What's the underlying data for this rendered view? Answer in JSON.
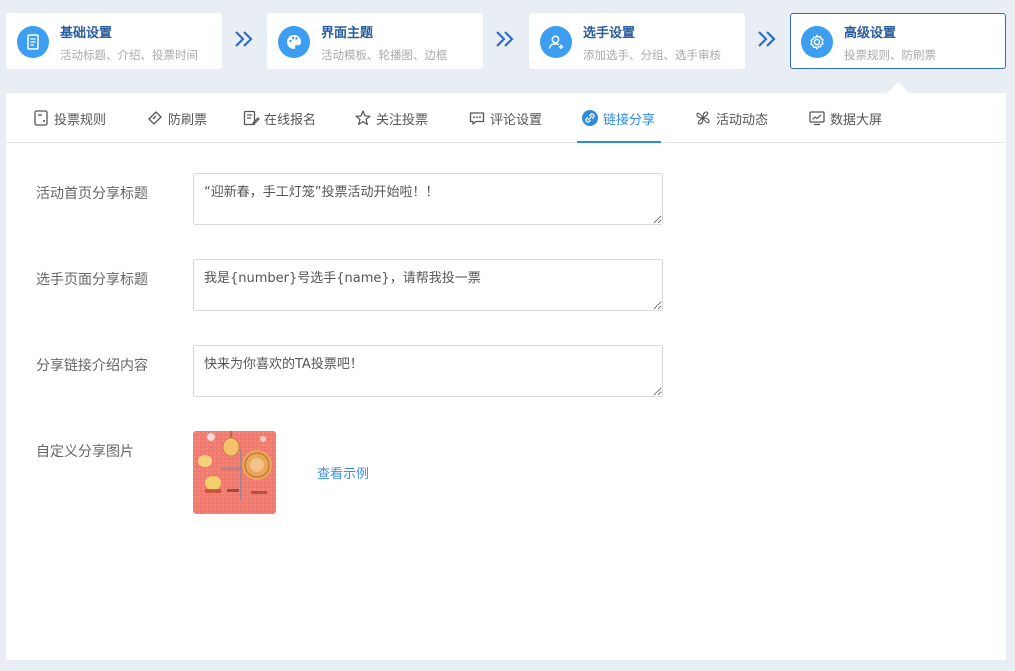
{
  "steps": [
    {
      "title": "基础设置",
      "sub": "活动标题、介绍、投票时间",
      "icon": "receipt-icon"
    },
    {
      "title": "界面主题",
      "sub": "活动模板、轮播图、边框",
      "icon": "palette-icon"
    },
    {
      "title": "选手设置",
      "sub": "添加选手、分组、选手审核",
      "icon": "user-add-icon"
    },
    {
      "title": "高级设置",
      "sub": "投票规则、防刷票",
      "icon": "gear-icon"
    }
  ],
  "active_step": 3,
  "tabs": [
    {
      "label": "投票规则",
      "icon": "rules-doc-icon"
    },
    {
      "label": "防刷票",
      "icon": "ticket-icon"
    },
    {
      "label": "在线报名",
      "icon": "edit-form-icon"
    },
    {
      "label": "关注投票",
      "icon": "star-icon"
    },
    {
      "label": "评论设置",
      "icon": "comment-icon"
    },
    {
      "label": "链接分享",
      "icon": "link-icon"
    },
    {
      "label": "活动动态",
      "icon": "pinwheel-icon"
    },
    {
      "label": "数据大屏",
      "icon": "monitor-chart-icon"
    }
  ],
  "active_tab": 5,
  "form": {
    "home_title_label": "活动首页分享标题",
    "home_title_value": "“迎新春，手工灯笼”投票活动开始啦！！",
    "player_title_label": "选手页面分享标题",
    "player_title_value": "我是{number}号选手{name}，请帮我投一票",
    "intro_label": "分享链接介绍内容",
    "intro_value": "快来为你喜欢的TA投票吧！",
    "image_label": "自定义分享图片",
    "view_example": "查看示例"
  },
  "colors": {
    "accent": "#2f8ae0",
    "step_title": "#2a5d9f",
    "icon_bg": "#3d9df0",
    "page_bg": "#e9edf4"
  }
}
